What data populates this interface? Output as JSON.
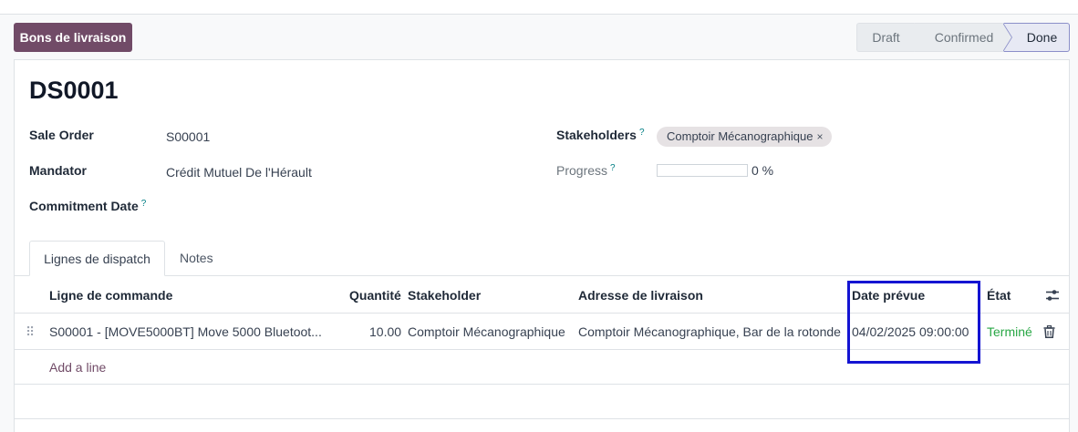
{
  "header": {
    "breadcrumb_button": "Bons de livraison",
    "stages": [
      "Draft",
      "Confirmed",
      "Done"
    ],
    "active_stage": "Done"
  },
  "record": {
    "title": "DS0001",
    "sale_order_label": "Sale Order",
    "sale_order_value": "S00001",
    "mandator_label": "Mandator",
    "mandator_value": "Crédit Mutuel De l'Hérault",
    "commitment_label": "Commitment Date",
    "help_mark": "?",
    "stakeholders_label": "Stakeholders",
    "stakeholder_tag": "Comptoir Mécanographique",
    "tag_remove": "×",
    "progress_label": "Progress",
    "progress_value": "0 %",
    "progress_fraction": 0
  },
  "tabs": [
    {
      "label": "Lignes de dispatch",
      "active": true
    },
    {
      "label": "Notes",
      "active": false
    }
  ],
  "table": {
    "columns": [
      "Ligne de commande",
      "Quantité",
      "Stakeholder",
      "Adresse de livraison",
      "Date prévue",
      "État"
    ],
    "rows": [
      {
        "order_line": "S00001 - [MOVE5000BT] Move 5000 Bluetoot...",
        "quantity": "10.00",
        "stakeholder": "Comptoir Mécanographique",
        "address": "Comptoir Mécanographique, Bar de la rotonde",
        "date": "04/02/2025 09:00:00",
        "state": "Terminé"
      }
    ],
    "add_line": "Add a line"
  },
  "colors": {
    "primary": "#714b67",
    "done_state": "#28a745",
    "highlight_box": "#1414d2",
    "help": "#017e84"
  },
  "icons": [
    "drag-handle-icon",
    "column-settings-icon",
    "trash-icon",
    "close-icon"
  ]
}
